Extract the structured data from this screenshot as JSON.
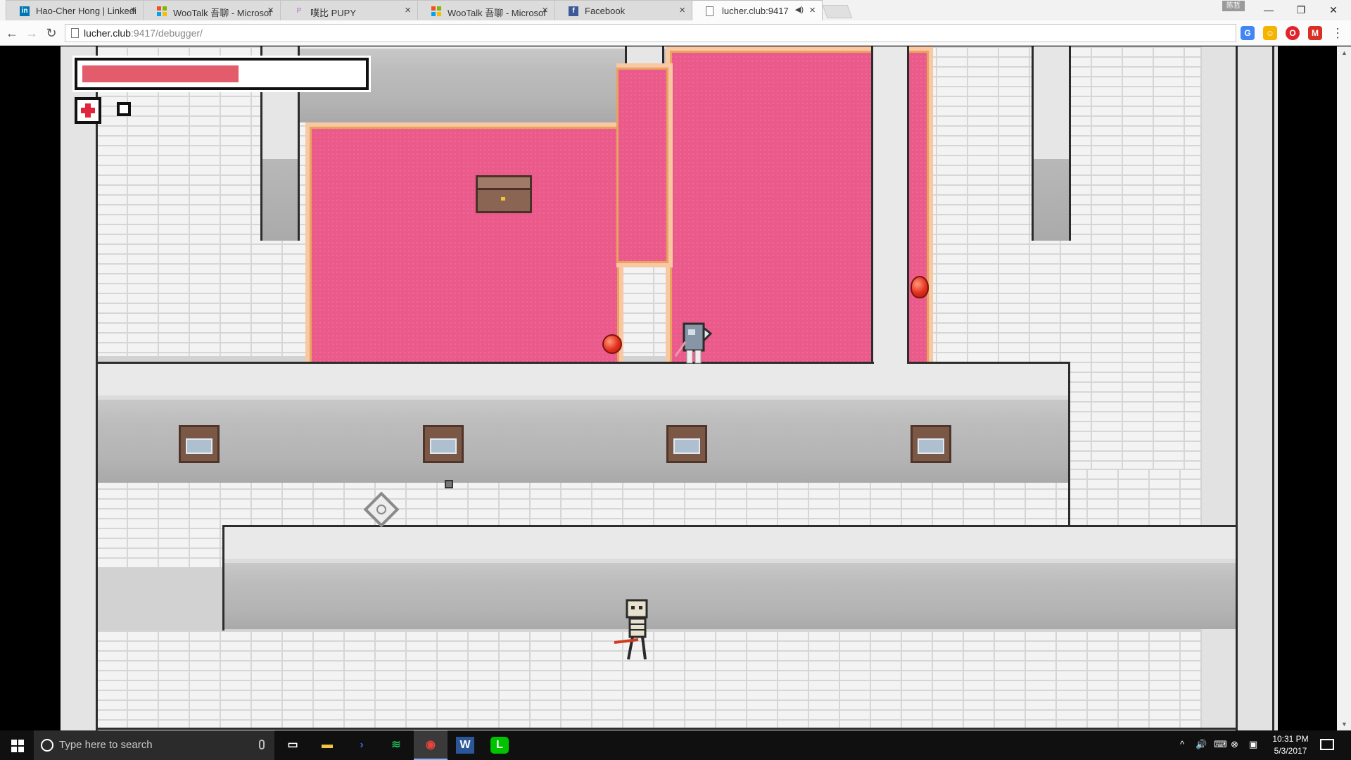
{
  "browser": {
    "tabs": [
      {
        "title": "Hao-Cher Hong | Linkedi",
        "icon": "linkedin-icon",
        "icon_glyph": "in",
        "icon_color": "#0077b5"
      },
      {
        "title": "WooTalk 吾聊 - Microsof",
        "icon": "microsoft-icon",
        "icon_glyph": "",
        "icon_color": "#f25022"
      },
      {
        "title": "噗比 PUPY",
        "icon": "pupy-icon",
        "icon_glyph": "P",
        "icon_color": "#c58ad6"
      },
      {
        "title": "WooTalk 吾聊 - Microsof",
        "icon": "microsoft-icon",
        "icon_glyph": "",
        "icon_color": "#f25022"
      },
      {
        "title": "Facebook",
        "icon": "facebook-icon",
        "icon_glyph": "f",
        "icon_color": "#3b5998"
      },
      {
        "title": "lucher.club:9417",
        "icon": "page-icon",
        "icon_glyph": "",
        "icon_color": "#ffffff",
        "active": true,
        "audio": true
      }
    ],
    "profile_label": "陈哲",
    "window_controls": {
      "minimize": "—",
      "maximize": "❐",
      "close": "✕"
    },
    "nav": {
      "back": "←",
      "forward": "→",
      "reload": "↻",
      "menu": "⋮"
    },
    "address": {
      "host": "lucher.club",
      "rest": ":9417/debugger/"
    },
    "extensions": [
      {
        "name": "translate-icon",
        "glyph": "G",
        "color": "#4285f4"
      },
      {
        "name": "emoji-icon",
        "glyph": "☺",
        "color": "#f4b400"
      },
      {
        "name": "opera-icon",
        "glyph": "O",
        "color": "#e0242b"
      },
      {
        "name": "gmail-icon",
        "glyph": "M",
        "color": "#d93025"
      }
    ]
  },
  "game": {
    "health_fraction": 0.56,
    "colors": {
      "health": "#e25c6c",
      "carpet": "#ea5b8b",
      "carpet_border": "#f8c7a4",
      "wall": "#bcbcbc",
      "floor": "#e9e9e9",
      "brick": "#f3f3f3"
    },
    "hud": {
      "item_slot_1": "medkit-icon",
      "item_slot_2": "empty-slot"
    }
  },
  "taskbar": {
    "search_placeholder": "Type here to search",
    "apps": [
      {
        "name": "task-view-icon",
        "glyph": "▭",
        "color": "#ffffff"
      },
      {
        "name": "file-explorer-icon",
        "glyph": "▬",
        "color": "#f4c542"
      },
      {
        "name": "powershell-icon",
        "glyph": "›",
        "color": "#2f6fd1"
      },
      {
        "name": "spotify-icon",
        "glyph": "≋",
        "color": "#1db954"
      },
      {
        "name": "chrome-icon",
        "glyph": "◉",
        "color": "#e8453c",
        "active": true
      },
      {
        "name": "word-icon",
        "glyph": "W",
        "color": "#2b579a"
      },
      {
        "name": "line-icon",
        "glyph": "L",
        "color": "#00c300"
      }
    ],
    "clock": {
      "time": "10:31 PM",
      "date": "5/3/2017"
    },
    "tray_glyphs": {
      "chevron": "^",
      "volume": "🔊",
      "network": "⌨",
      "close": "⊗",
      "message": "▣"
    }
  }
}
